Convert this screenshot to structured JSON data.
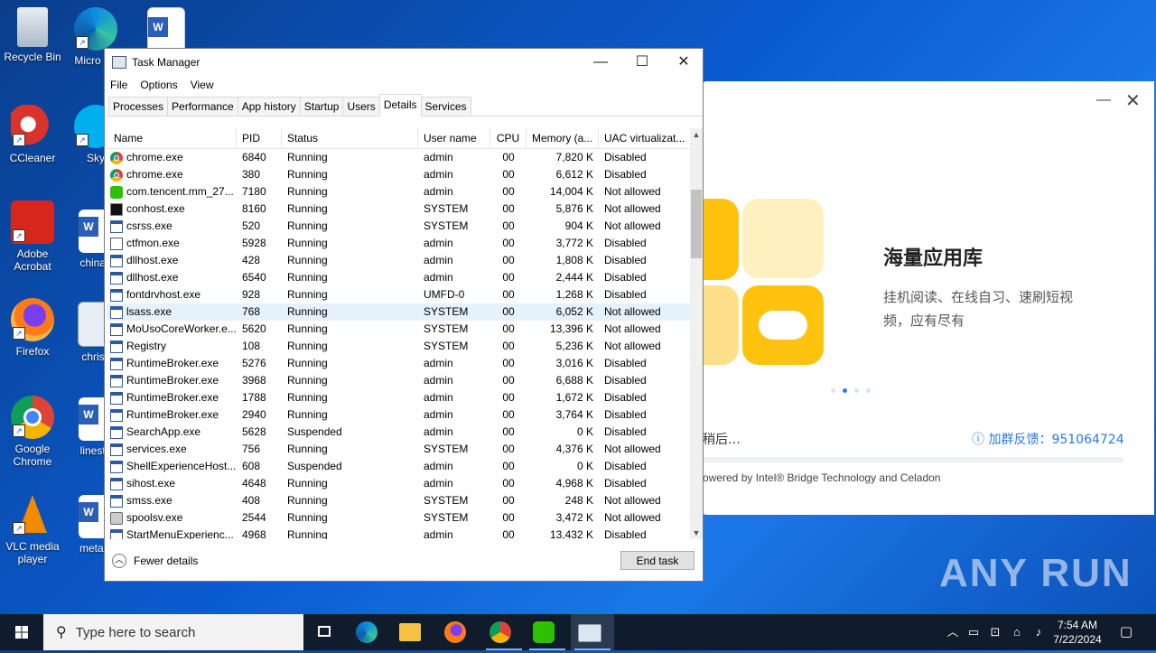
{
  "desktop": {
    "icons": [
      {
        "label": "Recycle Bin"
      },
      {
        "label": "Micro Ed"
      },
      {
        "label": "CCleaner"
      },
      {
        "label": "Sky"
      },
      {
        "label": "Adobe Acrobat"
      },
      {
        "label": "chinap"
      },
      {
        "label": "Firefox"
      },
      {
        "label": "christi"
      },
      {
        "label": "Google Chrome"
      },
      {
        "label": "lineste"
      },
      {
        "label": "VLC media player"
      },
      {
        "label": "metaln"
      }
    ]
  },
  "side_dialog": {
    "title": "海量应用库",
    "text": "挂机阅读、在线自习、速刷短视频，应有尽有",
    "after_text": "稍后…",
    "feedback": "加群反馈：951064724",
    "powered": "owered by Intel® Bridge Technology and Celadon",
    "colors": {
      "yellow": "#ffc20e",
      "light_yellow": "#fff0c0",
      "accent": "#2a7ae2"
    }
  },
  "taskmgr": {
    "title": "Task Manager",
    "menu": [
      "File",
      "Options",
      "View"
    ],
    "tabs": [
      "Processes",
      "Performance",
      "App history",
      "Startup",
      "Users",
      "Details",
      "Services"
    ],
    "active_tab": "Details",
    "columns": [
      "Name",
      "PID",
      "Status",
      "User name",
      "CPU",
      "Memory (a...",
      "UAC virtualizat..."
    ],
    "rows": [
      {
        "icon": "chrome",
        "name": "chrome.exe",
        "pid": "6840",
        "status": "Running",
        "user": "admin",
        "cpu": "00",
        "mem": "7,820 K",
        "uac": "Disabled"
      },
      {
        "icon": "chrome",
        "name": "chrome.exe",
        "pid": "380",
        "status": "Running",
        "user": "admin",
        "cpu": "00",
        "mem": "6,612 K",
        "uac": "Disabled"
      },
      {
        "icon": "wechat",
        "name": "com.tencent.mm_27...",
        "pid": "7180",
        "status": "Running",
        "user": "admin",
        "cpu": "00",
        "mem": "14,004 K",
        "uac": "Not allowed"
      },
      {
        "icon": "console",
        "name": "conhost.exe",
        "pid": "8160",
        "status": "Running",
        "user": "SYSTEM",
        "cpu": "00",
        "mem": "5,876 K",
        "uac": "Not allowed"
      },
      {
        "icon": "exe",
        "name": "csrss.exe",
        "pid": "520",
        "status": "Running",
        "user": "SYSTEM",
        "cpu": "00",
        "mem": "904 K",
        "uac": "Not allowed"
      },
      {
        "icon": "pen",
        "name": "ctfmon.exe",
        "pid": "5928",
        "status": "Running",
        "user": "admin",
        "cpu": "00",
        "mem": "3,772 K",
        "uac": "Disabled"
      },
      {
        "icon": "exe",
        "name": "dllhost.exe",
        "pid": "428",
        "status": "Running",
        "user": "admin",
        "cpu": "00",
        "mem": "1,808 K",
        "uac": "Disabled"
      },
      {
        "icon": "exe",
        "name": "dllhost.exe",
        "pid": "6540",
        "status": "Running",
        "user": "admin",
        "cpu": "00",
        "mem": "2,444 K",
        "uac": "Disabled"
      },
      {
        "icon": "exe",
        "name": "fontdrvhost.exe",
        "pid": "928",
        "status": "Running",
        "user": "UMFD-0",
        "cpu": "00",
        "mem": "1,268 K",
        "uac": "Disabled"
      },
      {
        "icon": "exe",
        "name": "lsass.exe",
        "pid": "768",
        "status": "Running",
        "user": "SYSTEM",
        "cpu": "00",
        "mem": "6,052 K",
        "uac": "Not allowed",
        "selected": true
      },
      {
        "icon": "exe",
        "name": "MoUsoCoreWorker.e...",
        "pid": "5620",
        "status": "Running",
        "user": "SYSTEM",
        "cpu": "00",
        "mem": "13,396 K",
        "uac": "Not allowed"
      },
      {
        "icon": "exe",
        "name": "Registry",
        "pid": "108",
        "status": "Running",
        "user": "SYSTEM",
        "cpu": "00",
        "mem": "5,236 K",
        "uac": "Not allowed"
      },
      {
        "icon": "exe",
        "name": "RuntimeBroker.exe",
        "pid": "5276",
        "status": "Running",
        "user": "admin",
        "cpu": "00",
        "mem": "3,016 K",
        "uac": "Disabled"
      },
      {
        "icon": "exe",
        "name": "RuntimeBroker.exe",
        "pid": "3968",
        "status": "Running",
        "user": "admin",
        "cpu": "00",
        "mem": "6,688 K",
        "uac": "Disabled"
      },
      {
        "icon": "exe",
        "name": "RuntimeBroker.exe",
        "pid": "1788",
        "status": "Running",
        "user": "admin",
        "cpu": "00",
        "mem": "1,672 K",
        "uac": "Disabled"
      },
      {
        "icon": "exe",
        "name": "RuntimeBroker.exe",
        "pid": "2940",
        "status": "Running",
        "user": "admin",
        "cpu": "00",
        "mem": "3,764 K",
        "uac": "Disabled"
      },
      {
        "icon": "exe",
        "name": "SearchApp.exe",
        "pid": "5628",
        "status": "Suspended",
        "user": "admin",
        "cpu": "00",
        "mem": "0 K",
        "uac": "Disabled"
      },
      {
        "icon": "exe",
        "name": "services.exe",
        "pid": "756",
        "status": "Running",
        "user": "SYSTEM",
        "cpu": "00",
        "mem": "4,376 K",
        "uac": "Not allowed"
      },
      {
        "icon": "exe",
        "name": "ShellExperienceHost....",
        "pid": "608",
        "status": "Suspended",
        "user": "admin",
        "cpu": "00",
        "mem": "0 K",
        "uac": "Disabled"
      },
      {
        "icon": "exe",
        "name": "sihost.exe",
        "pid": "4648",
        "status": "Running",
        "user": "admin",
        "cpu": "00",
        "mem": "4,968 K",
        "uac": "Disabled"
      },
      {
        "icon": "exe",
        "name": "smss.exe",
        "pid": "408",
        "status": "Running",
        "user": "SYSTEM",
        "cpu": "00",
        "mem": "248 K",
        "uac": "Not allowed"
      },
      {
        "icon": "printer",
        "name": "spoolsv.exe",
        "pid": "2544",
        "status": "Running",
        "user": "SYSTEM",
        "cpu": "00",
        "mem": "3,472 K",
        "uac": "Not allowed"
      },
      {
        "icon": "exe",
        "name": "StartMenuExperienc...",
        "pid": "4968",
        "status": "Running",
        "user": "admin",
        "cpu": "00",
        "mem": "13,432 K",
        "uac": "Disabled"
      }
    ],
    "fewer_details": "Fewer details",
    "end_task": "End task"
  },
  "taskbar": {
    "search_placeholder": "Type here to search",
    "time": "7:54 AM",
    "date": "7/22/2024"
  },
  "watermark": "ANY RUN"
}
